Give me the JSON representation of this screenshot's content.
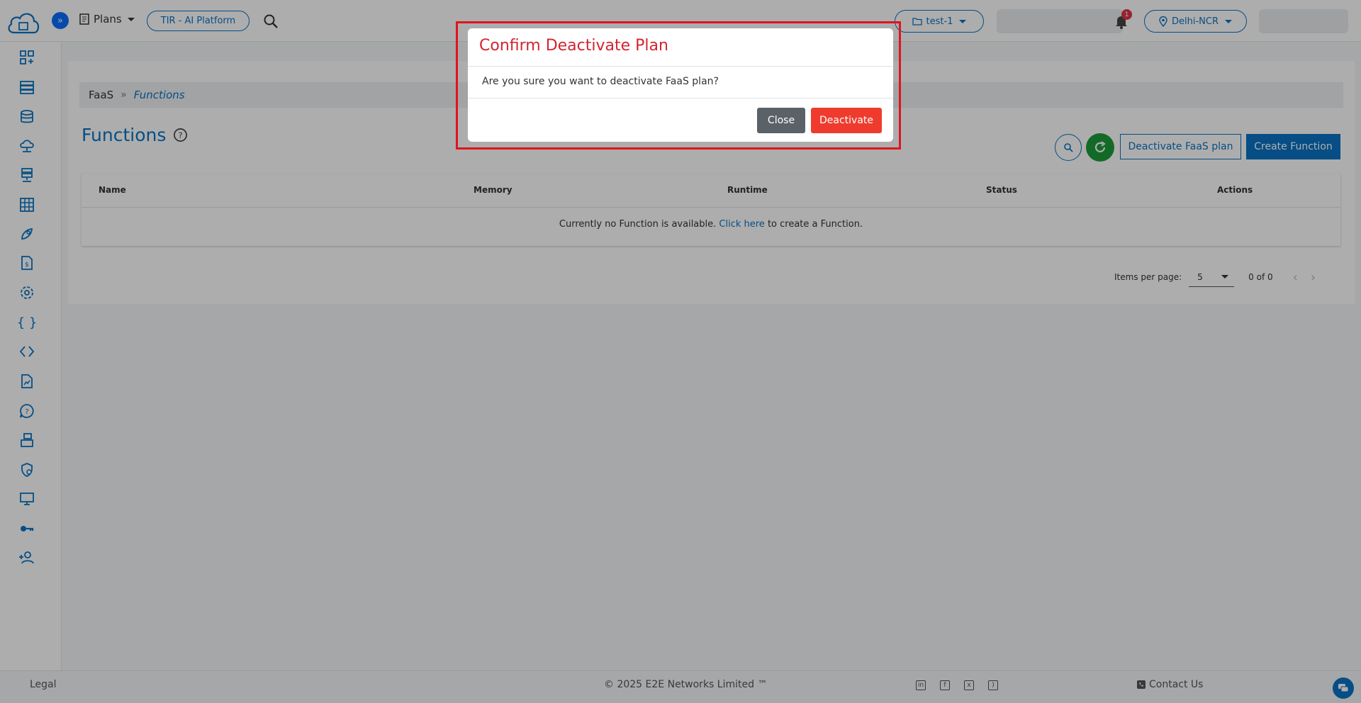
{
  "topbar": {
    "plans_label": "Plans",
    "platform_label": "TIR - AI Platform",
    "project_label": "test-1",
    "notification_count": "1",
    "region_label": "Delhi-NCR"
  },
  "breadcrumb": {
    "parent": "FaaS",
    "current": "Functions"
  },
  "page": {
    "title": "Functions",
    "deactivate_plan_label": "Deactivate FaaS plan",
    "create_label": "Create Function"
  },
  "table": {
    "columns": [
      "Name",
      "Memory",
      "Runtime",
      "Status",
      "Actions"
    ],
    "empty_prefix": "Currently no Function is available.",
    "empty_link": "Click here",
    "empty_suffix": "to create a Function."
  },
  "paginator": {
    "items_per_page_label": "Items per page:",
    "page_size": "5",
    "range": "0 of 0"
  },
  "footer": {
    "legal": "Legal",
    "copyright": "© 2025",
    "company": "E2E Networks Limited ™",
    "contact": "Contact Us"
  },
  "modal": {
    "title": "Confirm Deactivate Plan",
    "body": "Are you sure you want to deactivate FaaS plan?",
    "close_label": "Close",
    "deactivate_label": "Deactivate"
  },
  "colors": {
    "primary": "#0a74c4",
    "danger": "#ef3b2d",
    "title_red": "#d42430",
    "refresh_green": "#1c9c3a"
  }
}
